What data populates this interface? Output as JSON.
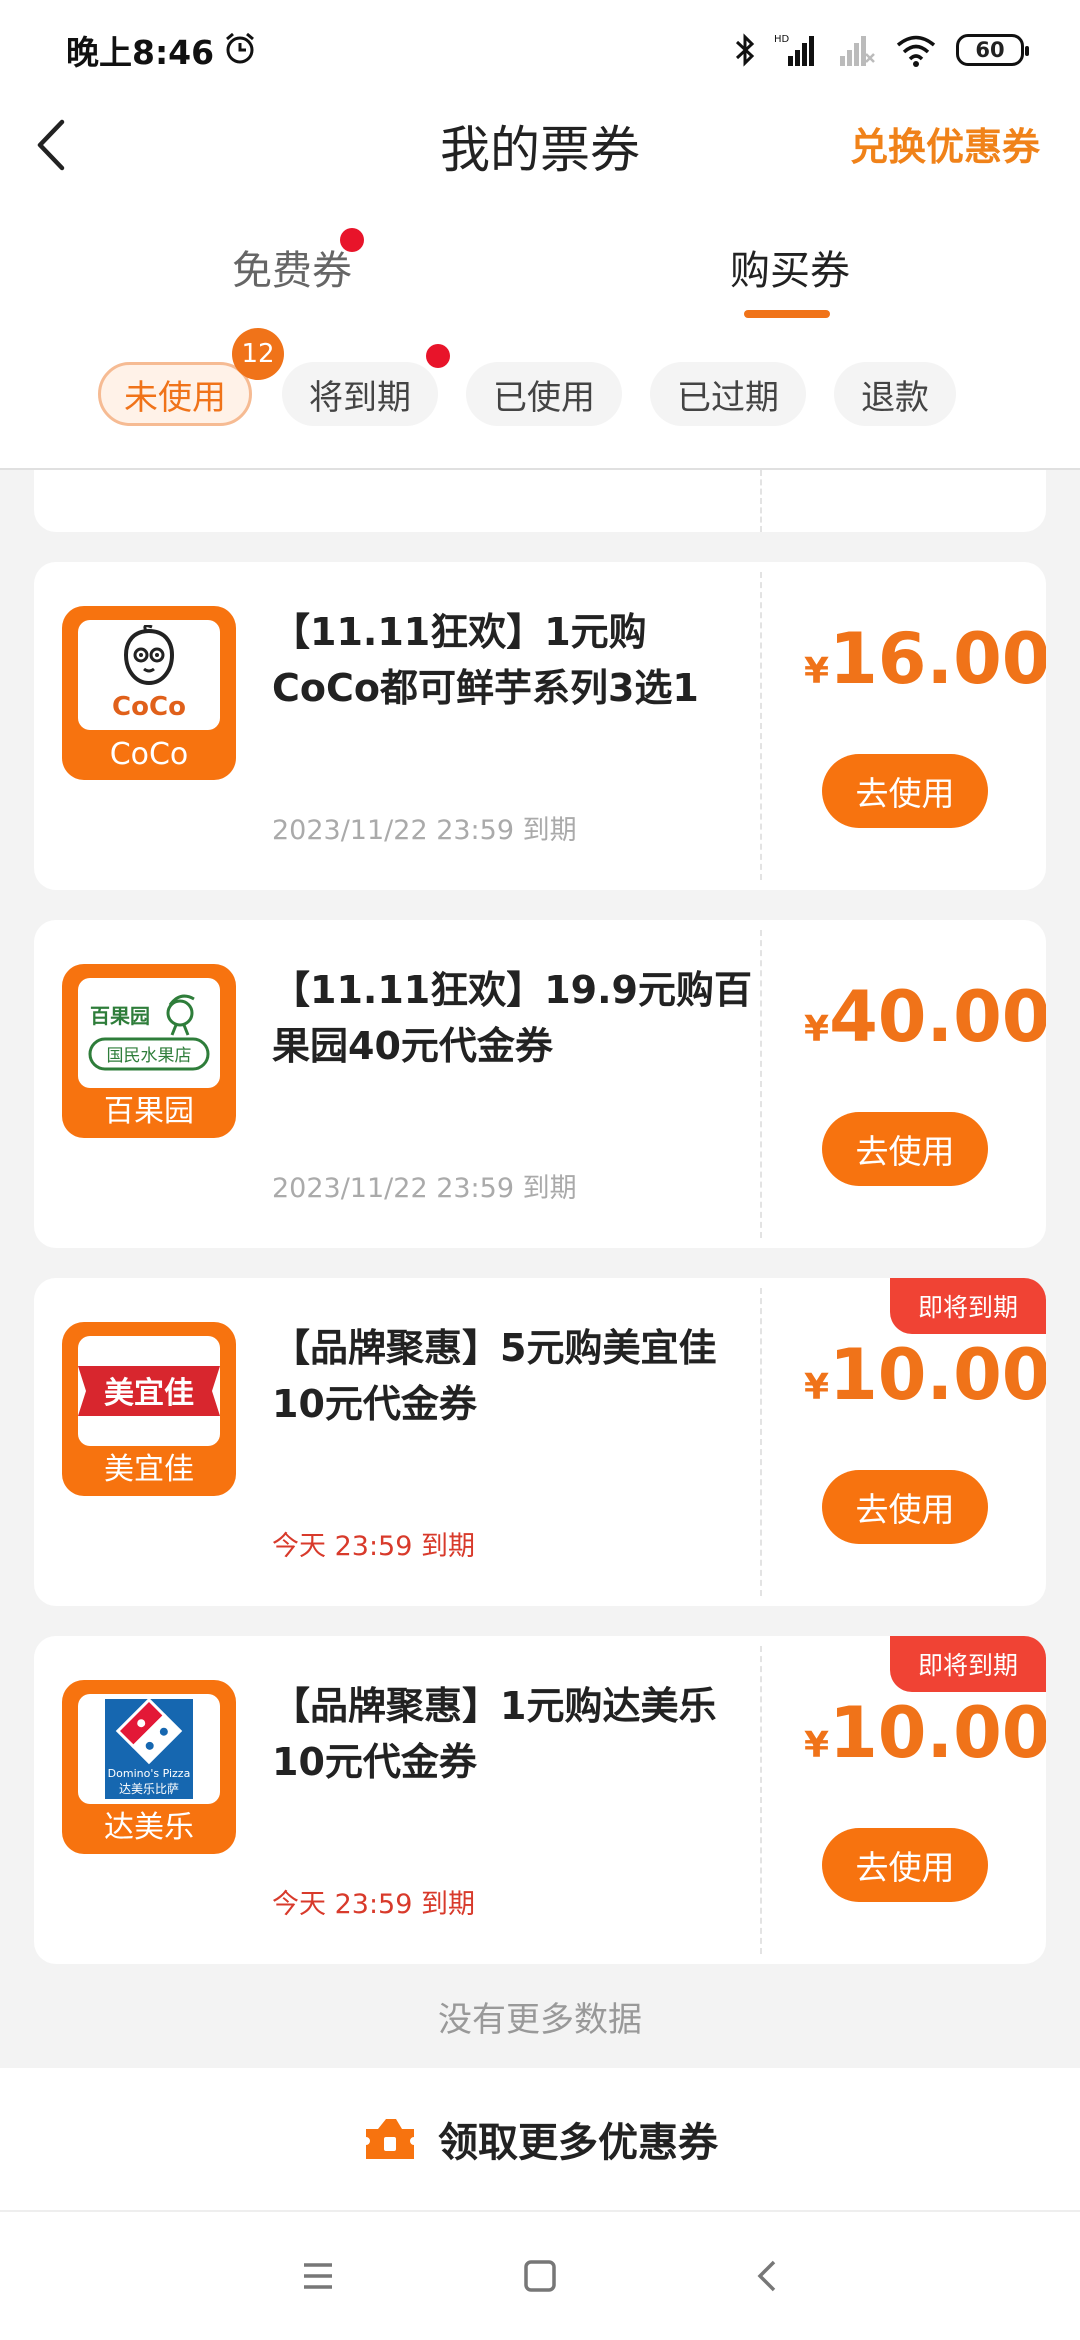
{
  "status_bar": {
    "time": "晚上8:46",
    "battery": "60"
  },
  "header": {
    "title": "我的票券",
    "action": "兑换优惠券"
  },
  "main_tabs": [
    {
      "label": "免费券"
    },
    {
      "label": "购买券"
    }
  ],
  "filters": [
    {
      "label": "未使用"
    },
    {
      "label": "将到期"
    },
    {
      "label": "已使用"
    },
    {
      "label": "已过期"
    },
    {
      "label": "退款"
    }
  ],
  "unused_count": "12",
  "coupons": [
    {
      "title": "【11.11狂欢】1元购CoCo都可鲜芋系列3选1",
      "brand": "CoCo",
      "logo_text": "CoCo",
      "currency": "¥",
      "price": "16.00",
      "expiry": "2023/11/22 23:59 到期",
      "button": "去使用"
    },
    {
      "title": "【11.11狂欢】19.9元购百果园40元代金券",
      "brand": "百果园",
      "logo_text": "百果园",
      "logo_sub": "国民水果店",
      "currency": "¥",
      "price": "40.00",
      "expiry": "2023/11/22 23:59 到期",
      "button": "去使用"
    },
    {
      "title": "【品牌聚惠】5元购美宜佳10元代金券",
      "brand": "美宜佳",
      "logo_text": "美宜佳",
      "currency": "¥",
      "price": "10.00",
      "expiry": "今天 23:59 到期",
      "badge": "即将到期",
      "button": "去使用"
    },
    {
      "title": "【品牌聚惠】1元购达美乐10元代金券",
      "brand": "达美乐",
      "logo_text": "Domino's Pizza",
      "logo_sub": "达美乐比萨",
      "currency": "¥",
      "price": "10.00",
      "expiry": "今天 23:59 到期",
      "badge": "即将到期",
      "button": "去使用"
    }
  ],
  "footer_note": "没有更多数据",
  "bottom_action": "领取更多优惠券",
  "colors": {
    "accent": "#f07319",
    "badge_red": "#f04334",
    "expiry_red": "#d83a2b"
  },
  "icons": [
    "back-arrow-icon",
    "alarm-icon",
    "bluetooth-icon",
    "signal-icon",
    "wifi-icon",
    "battery-icon",
    "coupon-icon",
    "menu-icon",
    "home-icon",
    "back-icon"
  ]
}
